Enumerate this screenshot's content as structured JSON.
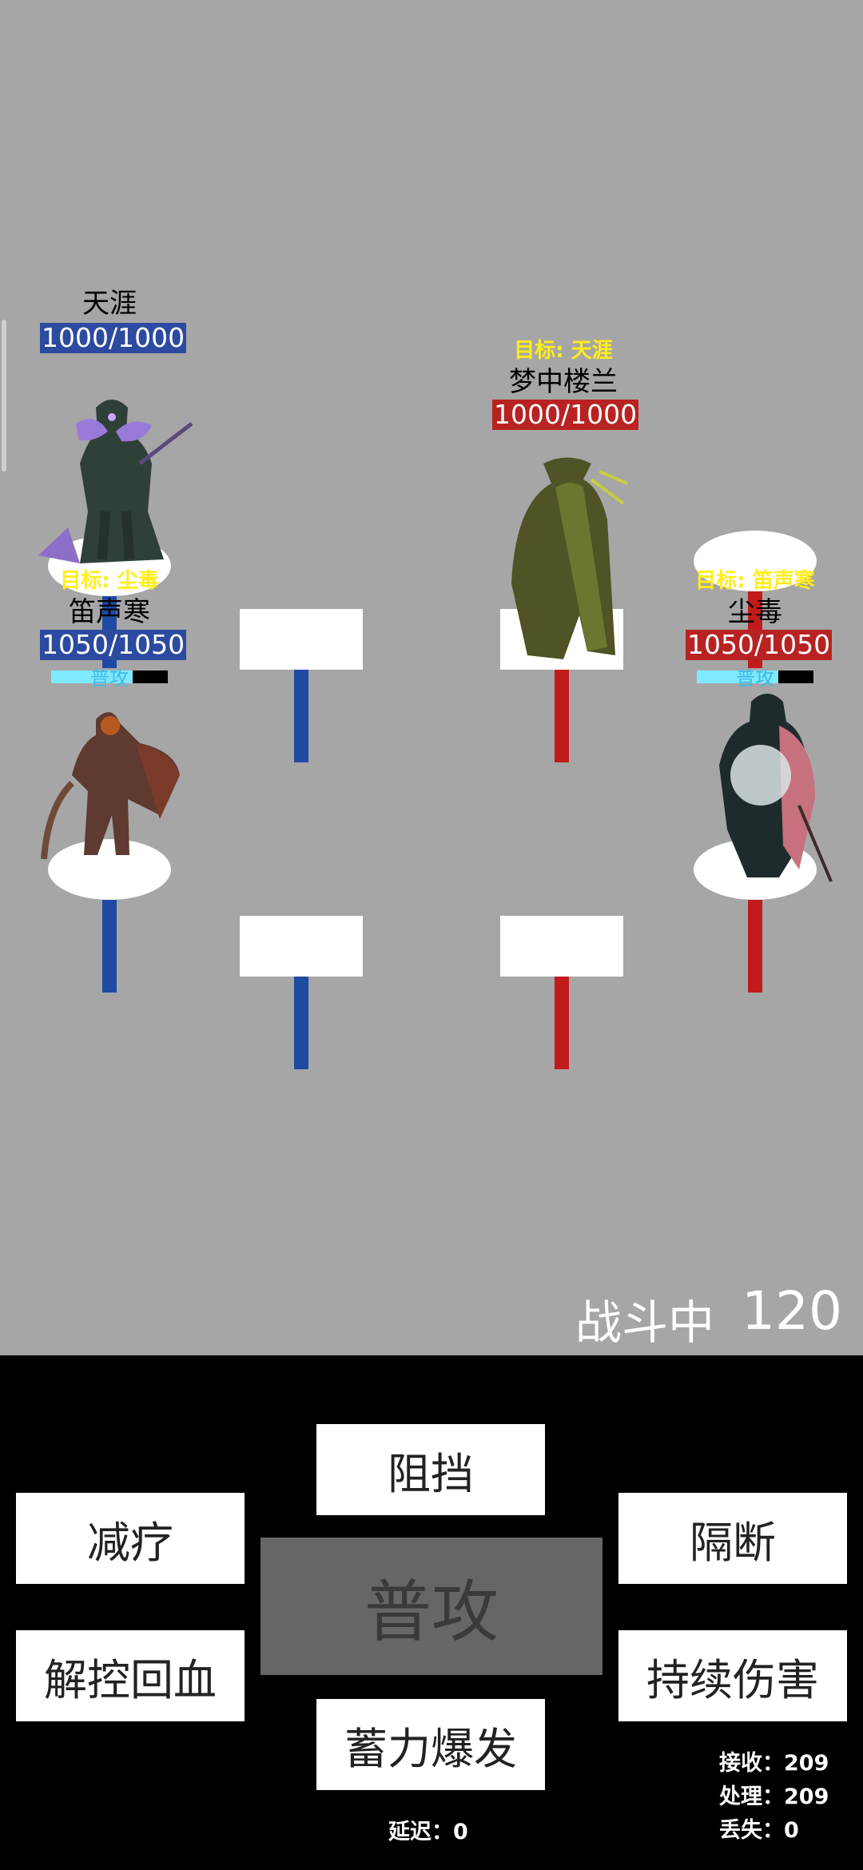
{
  "units": {
    "tianya": {
      "name": "天涯",
      "hp": "1000/1000"
    },
    "mengzhong": {
      "target": "目标: 天涯",
      "name": "梦中楼兰",
      "hp": "1000/1000"
    },
    "dishenghan": {
      "target": "目标: 尘毒",
      "name": "笛声寒",
      "hp": "1050/1050",
      "cast_label": "普攻",
      "cast_progress": 0.7
    },
    "chendu": {
      "target": "目标: 笛声寒",
      "name": "尘毒",
      "hp": "1050/1050",
      "cast_label": "普攻",
      "cast_progress": 0.7
    }
  },
  "battle": {
    "status": "战斗中",
    "timer": "120"
  },
  "skills": {
    "block": "阻挡",
    "heal_reduce": "减疗",
    "isolate": "隔断",
    "basic_attack": "普攻",
    "cleanse_heal": "解控回血",
    "dot": "持续伤害",
    "charge_burst": "蓄力爆发"
  },
  "stats": {
    "delay": "延迟：0",
    "received": "接收：209",
    "processed": "处理：209",
    "lost": "丢失：0"
  },
  "colors": {
    "team_blue": "#1f4aa2",
    "team_red": "#c21b1b",
    "target_yellow": "#ffee1a",
    "cast_cyan": "#7fe9ff"
  }
}
